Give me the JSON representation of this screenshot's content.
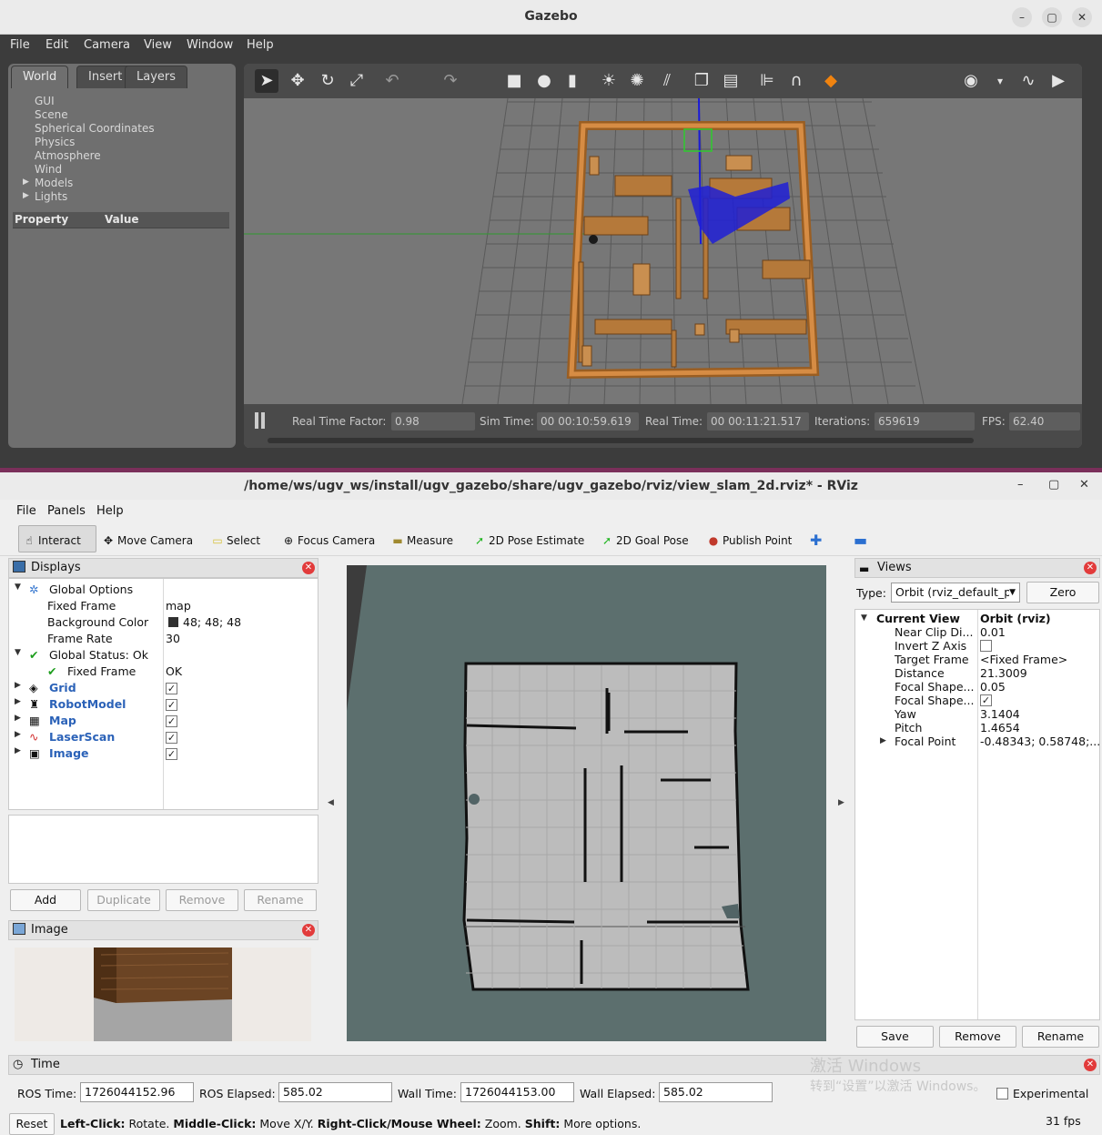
{
  "gazebo": {
    "title": "Gazebo",
    "window_buttons": {
      "minimize": "–",
      "maximize": "▢",
      "close": "✕"
    },
    "menu": [
      "File",
      "Edit",
      "Camera",
      "View",
      "Window",
      "Help"
    ],
    "tabs": [
      "World",
      "Insert",
      "Layers"
    ],
    "tree": [
      "GUI",
      "Scene",
      "Spherical Coordinates",
      "Physics",
      "Atmosphere",
      "Wind",
      "Models",
      "Lights"
    ],
    "property_header": {
      "property": "Property",
      "value": "Value"
    },
    "status": {
      "real_time_factor_label": "Real Time Factor:",
      "real_time_factor": "0.98",
      "sim_time_label": "Sim Time:",
      "sim_time": "00 00:10:59.619",
      "real_time_label": "Real Time:",
      "real_time": "00 00:11:21.517",
      "iterations_label": "Iterations:",
      "iterations": "659619",
      "fps_label": "FPS:",
      "fps": "62.40"
    }
  },
  "rviz": {
    "title": "/home/ws/ugv_ws/install/ugv_gazebo/share/ugv_gazebo/rviz/view_slam_2d.rviz* - RViz",
    "window_buttons": {
      "minimize": "–",
      "maximize": "▢",
      "close": "✕"
    },
    "menu": [
      "File",
      "Panels",
      "Help"
    ],
    "tools": [
      "Interact",
      "Move Camera",
      "Select",
      "Focus Camera",
      "Measure",
      "2D Pose Estimate",
      "2D Goal Pose",
      "Publish Point"
    ],
    "displays_panel": {
      "title": "Displays",
      "global_options": "Global Options",
      "fixed_frame_label": "Fixed Frame",
      "fixed_frame": "map",
      "background_color_label": "Background Color",
      "background_color": "48; 48; 48",
      "frame_rate_label": "Frame Rate",
      "frame_rate": "30",
      "global_status": "Global Status: Ok",
      "fixed_frame_status_label": "Fixed Frame",
      "fixed_frame_status": "OK",
      "items": [
        "Grid",
        "RobotModel",
        "Map",
        "LaserScan",
        "Image"
      ],
      "buttons": {
        "add": "Add",
        "duplicate": "Duplicate",
        "remove": "Remove",
        "rename": "Rename"
      }
    },
    "image_panel": {
      "title": "Image"
    },
    "views_panel": {
      "title": "Views",
      "type_label": "Type:",
      "type_value": "Orbit (rviz_default_p",
      "zero": "Zero",
      "current_view": "Current View",
      "current_view_value": "Orbit (rviz)",
      "props": [
        {
          "k": "Near Clip Di...",
          "v": "0.01"
        },
        {
          "k": "Invert Z Axis",
          "v": ""
        },
        {
          "k": "Target Frame",
          "v": "<Fixed Frame>"
        },
        {
          "k": "Distance",
          "v": "21.3009"
        },
        {
          "k": "Focal Shape...",
          "v": "0.05"
        },
        {
          "k": "Focal Shape...",
          "v": ""
        },
        {
          "k": "Yaw",
          "v": "3.1404"
        },
        {
          "k": "Pitch",
          "v": "1.4654"
        },
        {
          "k": "Focal Point",
          "v": "-0.48343; 0.58748;..."
        }
      ],
      "buttons": {
        "save": "Save",
        "remove": "Remove",
        "rename": "Rename"
      }
    },
    "time_panel": {
      "title": "Time",
      "ros_time_label": "ROS Time:",
      "ros_time": "1726044152.96",
      "ros_elapsed_label": "ROS Elapsed:",
      "ros_elapsed": "585.02",
      "wall_time_label": "Wall Time:",
      "wall_time": "1726044153.00",
      "wall_elapsed_label": "Wall Elapsed:",
      "wall_elapsed": "585.02",
      "experimental": "Experimental"
    },
    "statusbar": {
      "reset": "Reset",
      "hint_b1": "Left-Click:",
      "hint_t1": " Rotate. ",
      "hint_b2": "Middle-Click:",
      "hint_t2": " Move X/Y. ",
      "hint_b3": "Right-Click/Mouse Wheel:",
      "hint_t3": " Zoom. ",
      "hint_b4": "Shift:",
      "hint_t4": " More options.",
      "fps": "31 fps"
    },
    "watermark": {
      "line1": "激活 Windows",
      "line2": "转到“设置”以激活 Windows。"
    }
  }
}
